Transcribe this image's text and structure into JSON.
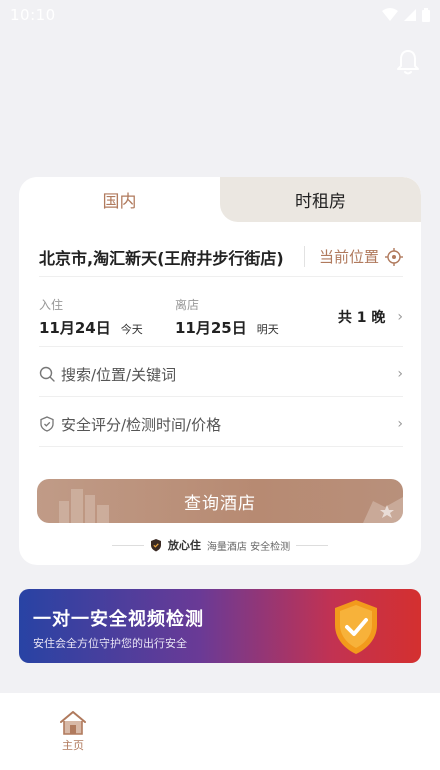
{
  "status_bar": {
    "time": "10:10",
    "icons": [
      "wifi-icon",
      "signal-icon",
      "battery-icon"
    ]
  },
  "header": {
    "bell_icon": "bell-icon"
  },
  "search_card": {
    "tabs": [
      {
        "label": "国内",
        "active": true
      },
      {
        "label": "时租房",
        "active": false
      }
    ],
    "city": "北京市,淘汇新天(王府井步行街店)",
    "current_location_label": "当前位置",
    "check_in": {
      "label": "入住",
      "date": "11月24日",
      "day": "今天"
    },
    "check_out": {
      "label": "离店",
      "date": "11月25日",
      "day": "明天"
    },
    "nights": "共 1 晚",
    "search_placeholder": "搜索/位置/关键词",
    "filter_placeholder": "安全评分/检测时间/价格",
    "query_button": "查询酒店",
    "assurance": {
      "badge": "放心住",
      "text": "海量酒店 安全检测"
    }
  },
  "banner": {
    "title": "一对一安全视频检测",
    "subtitle": "安住会全方位守护您的出行安全"
  },
  "bottom_nav": {
    "items": [
      {
        "label": "主页",
        "icon": "home-icon",
        "active": true
      }
    ]
  },
  "colors": {
    "accent": "#b07a5d",
    "button": "#b78a72",
    "banner_start": "#2843a4",
    "banner_end": "#d4302f",
    "shield": "#f29a1c"
  }
}
